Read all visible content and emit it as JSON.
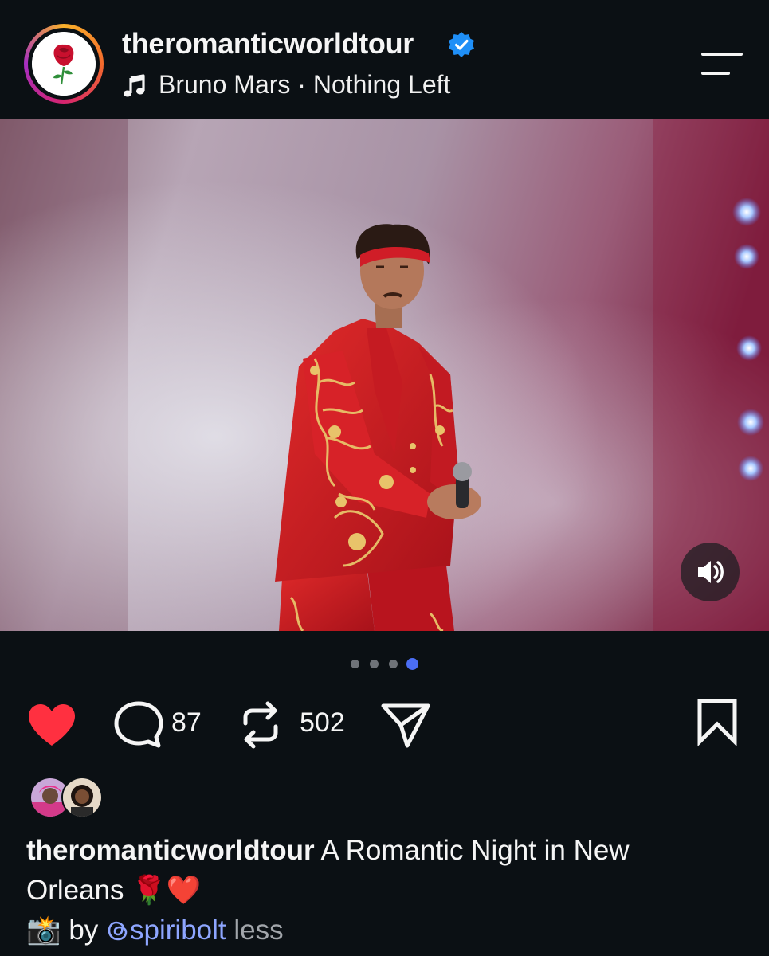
{
  "header": {
    "username": "theromanticworldtour",
    "music": "Bruno Mars · Nothing Left"
  },
  "post": {
    "carousel": {
      "count": 4,
      "active_index": 3
    },
    "likes_liked": true,
    "comments": "87",
    "reposts": "502"
  },
  "caption": {
    "username": "theromanticworldtour",
    "text_line1": "A Romantic Night in New",
    "text_line2": "Orleans",
    "emoji_rose": "🌹",
    "emoji_heart": "❤️",
    "emoji_camera": "📸",
    "by": "by",
    "mention": "@spiribolt",
    "less": "less"
  },
  "icons": {
    "verified": "verified-badge-icon",
    "music": "music-note-icon",
    "menu": "menu-icon",
    "like": "heart-icon",
    "comment": "comment-icon",
    "repost": "repost-icon",
    "share": "send-icon",
    "save": "bookmark-icon",
    "sound": "speaker-icon"
  },
  "colors": {
    "background": "#0b1014",
    "like": "#ff3040",
    "verified": "#1f8ff7",
    "mention": "#8ea6ff",
    "active_dot": "#4b6ef5"
  }
}
